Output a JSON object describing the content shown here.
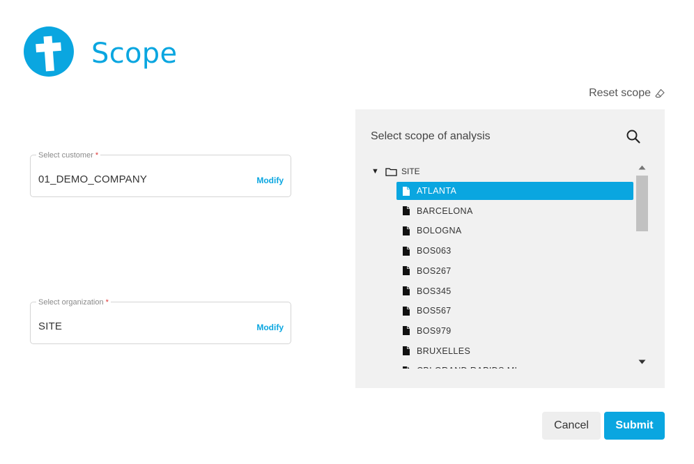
{
  "header": {
    "title": "Scope",
    "logo_icon": "cross-logo-icon"
  },
  "reset": {
    "label": "Reset scope",
    "icon": "eraser-icon"
  },
  "customer": {
    "label": "Select customer",
    "required_mark": "*",
    "value": "01_DEMO_COMPANY",
    "action": "Modify"
  },
  "organization": {
    "label": "Select organization",
    "required_mark": "*",
    "value": "SITE",
    "action": "Modify"
  },
  "scope_panel": {
    "heading": "Select scope of analysis",
    "search_icon": "search-icon",
    "tree": {
      "root": {
        "toggle": "▼",
        "label": "SITE",
        "expanded": true
      },
      "items": [
        {
          "label": "ATLANTA",
          "selected": true
        },
        {
          "label": "BARCELONA",
          "selected": false
        },
        {
          "label": "BOLOGNA",
          "selected": false
        },
        {
          "label": "BOS063",
          "selected": false
        },
        {
          "label": "BOS267",
          "selected": false
        },
        {
          "label": "BOS345",
          "selected": false
        },
        {
          "label": "BOS567",
          "selected": false
        },
        {
          "label": "BOS979",
          "selected": false
        },
        {
          "label": "BRUXELLES",
          "selected": false
        },
        {
          "label": "CBI GRAND RAPIDS MI",
          "selected": false
        }
      ]
    }
  },
  "actions": {
    "cancel": "Cancel",
    "submit": "Submit"
  },
  "colors": {
    "accent": "#0aa6e0",
    "panel_bg": "#f1f1f1",
    "required": "#dd3333"
  }
}
